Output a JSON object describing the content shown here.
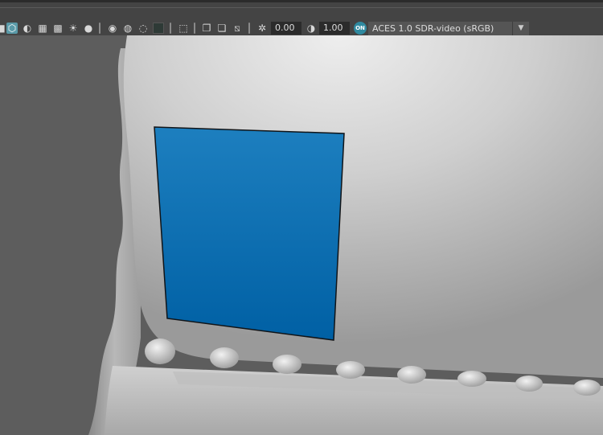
{
  "toolbar": {
    "icons": [
      "shaded-mode-icon",
      "wireframe-on-shaded-icon",
      "default-material-icon",
      "textures-icon",
      "use-all-lights-icon",
      "shadows-icon",
      "ambient-occlusion-icon",
      "motion-blur-icon",
      "anti-aliasing-icon",
      "depth-of-field-icon",
      "isolate-select-icon",
      "xray-icon",
      "xray-joints-icon",
      "xray-active-components-icon",
      "exposure-icon",
      "gamma-icon",
      "color-management-icon"
    ],
    "exposure_value": "0.00",
    "gamma_value": "1.00",
    "color_management_badge": "ON",
    "view_transform": "ACES 1.0 SDR-video (sRGB)",
    "view_transform_arrow": "▼"
  },
  "viewport": {
    "background_color": "#5c5c5c",
    "selected_face_color": "#0a6fae",
    "surface_color": "#c4c4c4"
  }
}
